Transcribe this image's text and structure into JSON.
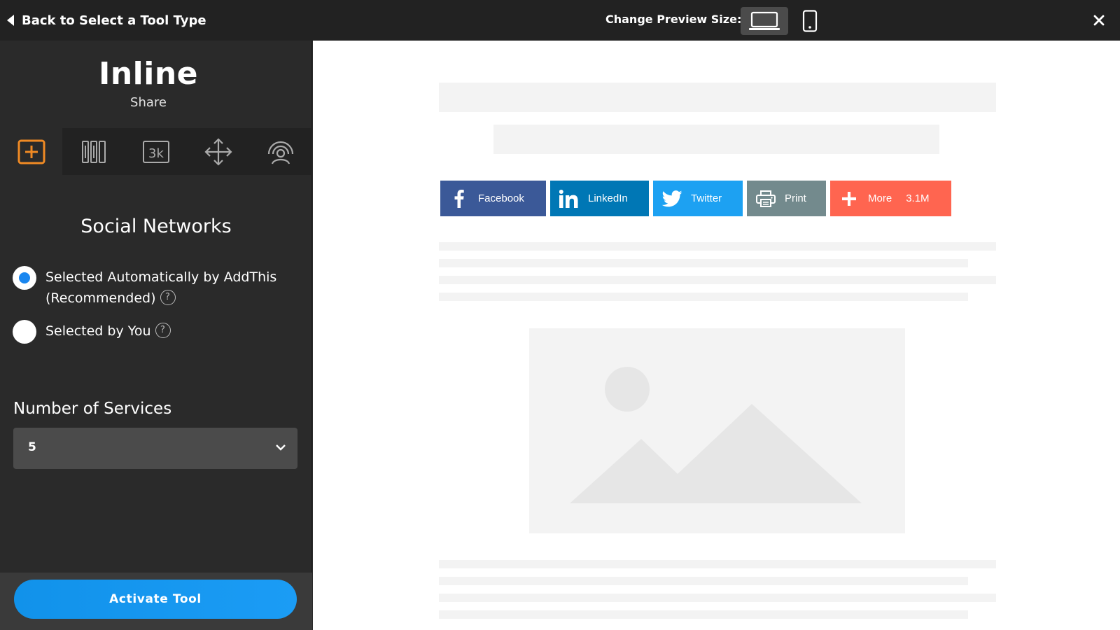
{
  "header": {
    "back_label": "Back to Select a Tool Type",
    "preview_label": "Change Preview Size:"
  },
  "sidebar": {
    "title": "Inline",
    "subtitle": "Share",
    "tabs": [
      {
        "icon": "add-box-icon",
        "active": true
      },
      {
        "icon": "columns-icon",
        "active": false
      },
      {
        "icon": "counter-3k-icon",
        "active": false
      },
      {
        "icon": "move-arrows-icon",
        "active": false
      },
      {
        "icon": "audience-targeting-icon",
        "active": false
      }
    ],
    "counter_tab_text": "3k",
    "section_title": "Social Networks",
    "options": {
      "auto_label": "Selected Automatically by AddThis",
      "auto_sub": "(Recommended)",
      "manual_label": "Selected by You",
      "selected": "auto",
      "help_glyph": "?"
    },
    "services_label": "Number of Services",
    "services_value": "5",
    "activate_label": "Activate Tool"
  },
  "preview": {
    "buttons": {
      "facebook": {
        "label": "Facebook",
        "color": "#3b5998"
      },
      "linkedin": {
        "label": "LinkedIn",
        "color": "#0077b5"
      },
      "twitter": {
        "label": "Twitter",
        "color": "#1da1f2"
      },
      "print": {
        "label": "Print",
        "color": "#738a8d"
      },
      "more": {
        "label": "More",
        "count": "3.1M",
        "color": "#ff6550"
      }
    }
  },
  "colors": {
    "accent_blue": "#1a87f0",
    "active_tab_orange": "#f08a24"
  }
}
